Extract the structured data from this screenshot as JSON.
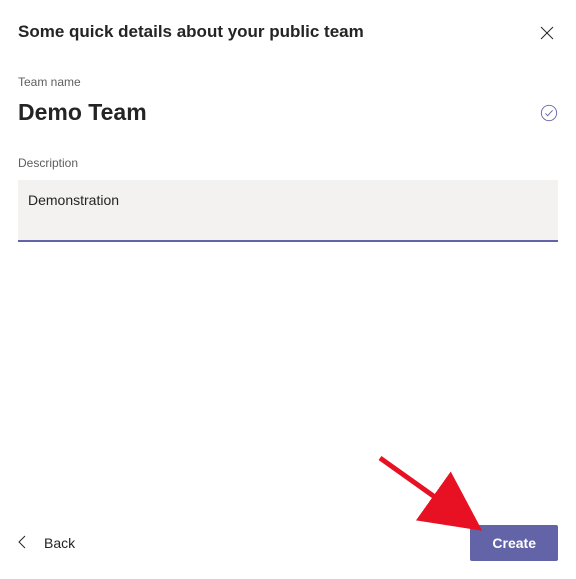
{
  "colors": {
    "accent": "#6264a7",
    "inputBg": "#f3f2f1",
    "text": "#252423",
    "muted": "#605e5c",
    "arrow": "#e81123"
  },
  "header": {
    "title": "Some quick details about your public team"
  },
  "fields": {
    "teamName": {
      "label": "Team name",
      "value": "Demo Team"
    },
    "description": {
      "label": "Description",
      "value": "Demonstration"
    }
  },
  "footer": {
    "backLabel": "Back",
    "createLabel": "Create"
  }
}
